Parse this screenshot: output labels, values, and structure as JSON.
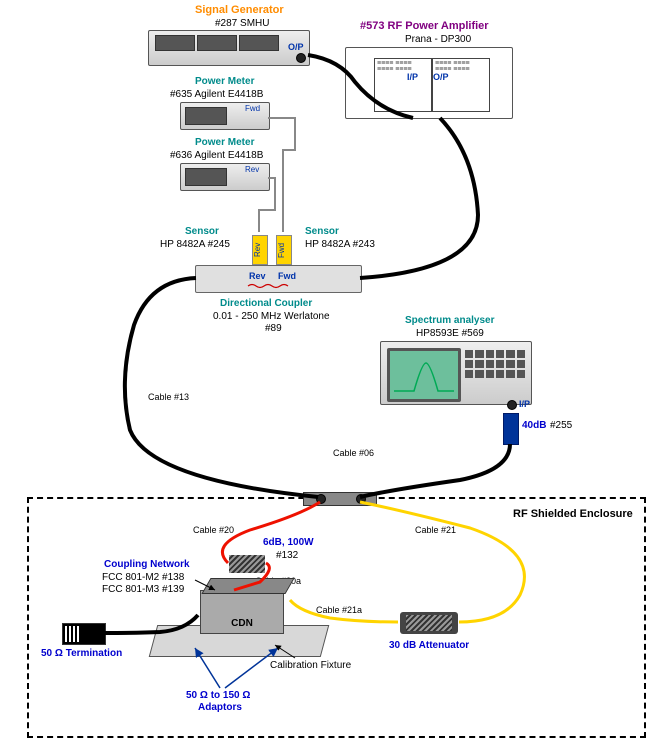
{
  "signal_generator": {
    "title": "Signal Generator",
    "id": "#287 SMHU",
    "port_out": "O/P"
  },
  "amplifier": {
    "title": "#573 RF Power Amplifier",
    "model": "Prana - DP300",
    "port_in": "I/P",
    "port_out": "O/P"
  },
  "power_meter_fwd": {
    "title": "Power Meter",
    "model": "#635 Agilent E4418B",
    "tag": "Fwd"
  },
  "power_meter_rev": {
    "title": "Power Meter",
    "model": "#636 Agilent E4418B",
    "tag": "Rev"
  },
  "sensor_rev": {
    "title": "Sensor",
    "model": "HP 8482A #245",
    "tag": "Rev"
  },
  "sensor_fwd": {
    "title": "Sensor",
    "model": "HP 8482A #243",
    "tag": "Fwd"
  },
  "coupler": {
    "title": "Directional Coupler",
    "spec": "0.01 - 250 MHz  Werlatone",
    "id": "#89",
    "rev": "Rev",
    "fwd": "Fwd"
  },
  "spectrum": {
    "title": "Spectrum analyser",
    "model": "HP8593E #569",
    "port_in": "I/P"
  },
  "atten_40": {
    "label": "40dB",
    "id": "#255"
  },
  "cables": {
    "c13": "Cable #13",
    "c06": "Cable #06",
    "c20": "Cable #20",
    "c20a": "Cable #20a",
    "c21": "Cable #21",
    "c21a": "Cable #21a"
  },
  "enclosure": {
    "title": "RF Shielded Enclosure"
  },
  "coupling_network": {
    "title": "Coupling Network",
    "m2": "FCC 801-M2 #138",
    "m3": "FCC 801-M3 #139"
  },
  "cdn": {
    "label": "CDN"
  },
  "atten_6": {
    "label": "6dB, 100W",
    "id": "#132"
  },
  "termination": {
    "label": "50 Ω Termination"
  },
  "adaptors": {
    "label1": "50 Ω to 150 Ω",
    "label2": "Adaptors"
  },
  "cal_fixture": {
    "label": "Calibration Fixture"
  },
  "atten_30": {
    "label": "30 dB Attenuator"
  }
}
